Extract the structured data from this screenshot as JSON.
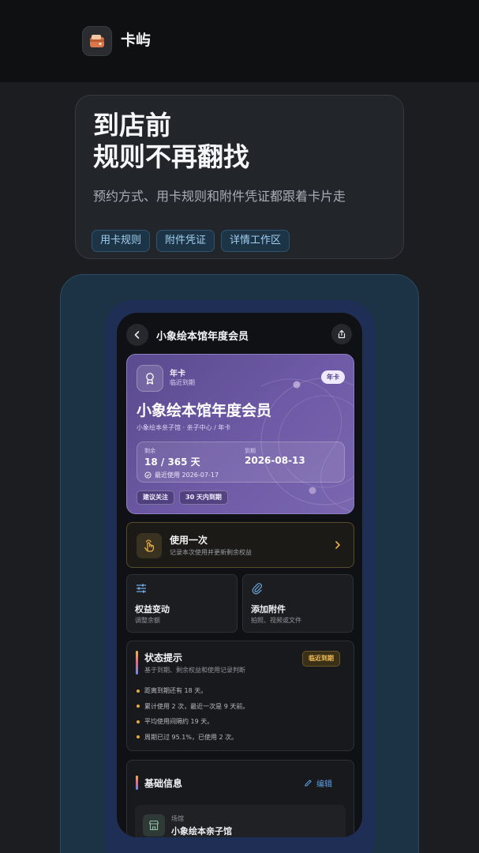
{
  "app": {
    "name": "卡屿",
    "icon": "wallet-icon"
  },
  "hero": {
    "title_line1": "到店前",
    "title_line2": "规则不再翻找",
    "subtitle": "预约方式、用卡规则和附件凭证都跟着卡片走",
    "chips": [
      "用卡规则",
      "附件凭证",
      "详情工作区"
    ]
  },
  "detail": {
    "nav_title": "小象绘本馆年度会员",
    "card": {
      "type": "年卡",
      "status": "临近到期",
      "tag": "年卡",
      "title": "小象绘本馆年度会员",
      "meta": "小象绘本亲子馆 · 亲子中心 / 年卡",
      "remaining_label": "剩余",
      "remaining_value": "18 / 365 天",
      "expiry_label": "到期",
      "expiry_value": "2026-08-13",
      "last_used": "最近使用 2026-07-17",
      "pills": [
        "建议关注",
        "30 天内到期"
      ]
    },
    "use_once": {
      "title": "使用一次",
      "subtitle": "记录本次使用并更新剩余权益"
    },
    "tiles": [
      {
        "title": "权益变动",
        "subtitle": "调整余额",
        "icon": "sliders-icon"
      },
      {
        "title": "添加附件",
        "subtitle": "拍照、视频或文件",
        "icon": "paperclip-icon"
      }
    ],
    "status": {
      "title": "状态提示",
      "subtitle": "基于到期、剩余权益和使用记录判断",
      "tag": "临近到期",
      "items": [
        "距离到期还有 18 天。",
        "累计使用 2 次，最近一次是 9 天前。",
        "平均使用间隔约 19 天。",
        "周期已过 95.1%，已使用 2 次。"
      ]
    },
    "basic": {
      "title": "基础信息",
      "edit_label": "编辑",
      "venue_label": "场馆",
      "venue_value": "小象绘本亲子馆"
    }
  },
  "colors": {
    "background": "#1b1d21",
    "card_purple": "#6e5aa6",
    "warning": "#f0bd55",
    "link_blue": "#5c9fe0"
  }
}
